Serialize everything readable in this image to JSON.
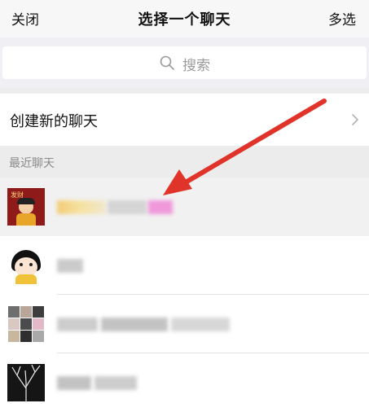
{
  "header": {
    "close_label": "关闭",
    "title": "选择一个聊天",
    "multiselect_label": "多选"
  },
  "search": {
    "placeholder": "搜索"
  },
  "create_chat": {
    "label": "创建新的聊天"
  },
  "recent": {
    "section_label": "最近聊天",
    "items": [
      {
        "avatar": "red-poster-avatar",
        "highlighted": true
      },
      {
        "avatar": "cartoon-face-avatar",
        "highlighted": false
      },
      {
        "avatar": "photo-grid-avatar",
        "highlighted": false
      },
      {
        "avatar": "dark-tree-avatar",
        "highlighted": false
      }
    ]
  },
  "avatar_badge_text": "发财",
  "colors": {
    "arrow": "#e0342b",
    "header_bg": "#f7f7f7",
    "page_bg": "#ededed"
  },
  "icons": [
    "search-icon",
    "chevron-right-icon",
    "red-arrow-annotation"
  ]
}
